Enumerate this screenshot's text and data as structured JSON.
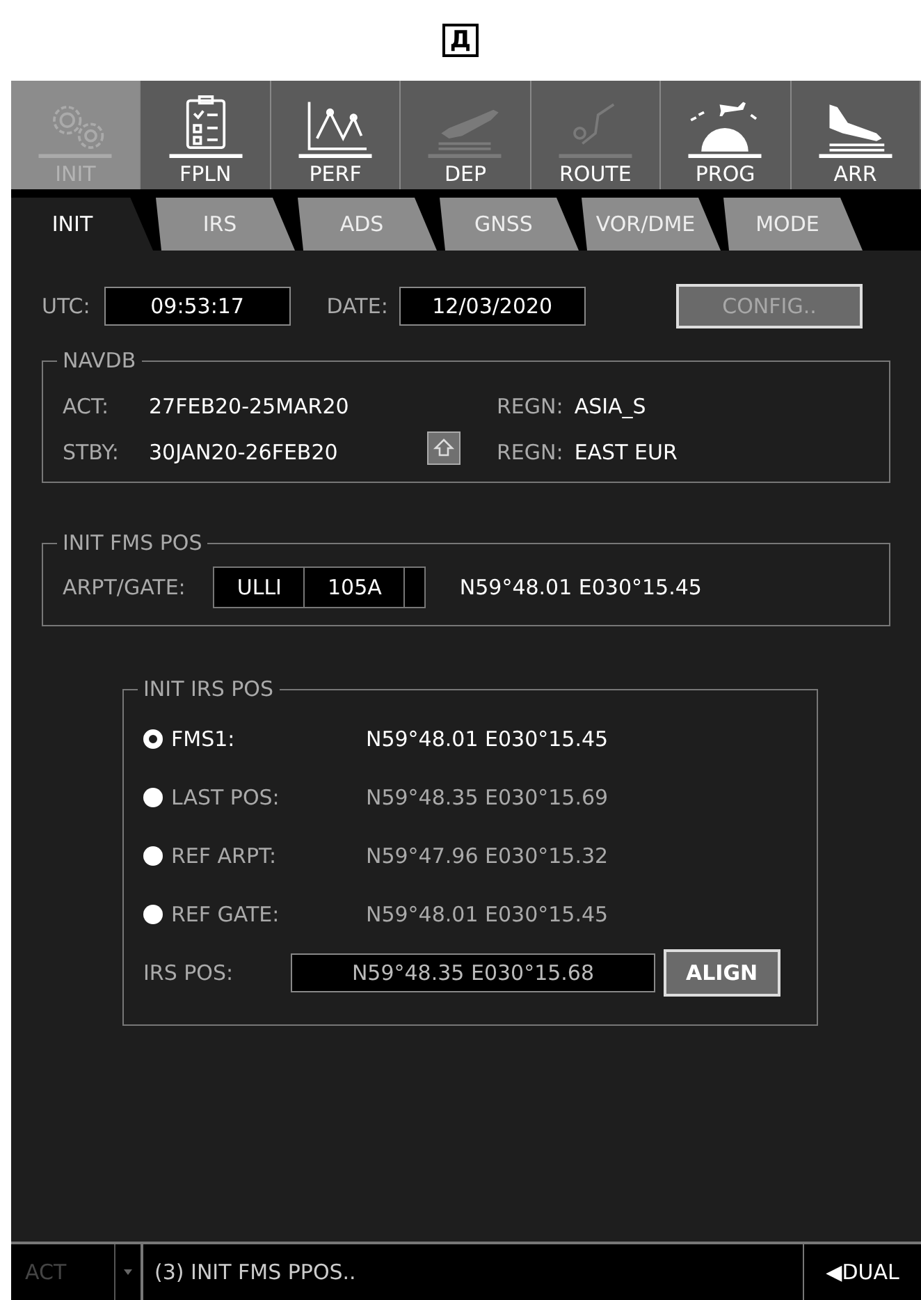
{
  "figure_label": "Д",
  "nav": [
    {
      "label": "INIT",
      "kind": "gear",
      "selected": true,
      "dimmed": false
    },
    {
      "label": "FPLN",
      "kind": "clipboard",
      "selected": false,
      "dimmed": false
    },
    {
      "label": "PERF",
      "kind": "chart",
      "selected": false,
      "dimmed": false
    },
    {
      "label": "DEP",
      "kind": "takeoff",
      "selected": false,
      "dimmed": true
    },
    {
      "label": "ROUTE",
      "kind": "route",
      "selected": false,
      "dimmed": true
    },
    {
      "label": "PROG",
      "kind": "progress",
      "selected": false,
      "dimmed": false
    },
    {
      "label": "ARR",
      "kind": "landing",
      "selected": false,
      "dimmed": false
    }
  ],
  "tabs": [
    {
      "label": "INIT",
      "selected": true
    },
    {
      "label": "IRS",
      "selected": false
    },
    {
      "label": "ADS",
      "selected": false
    },
    {
      "label": "GNSS",
      "selected": false
    },
    {
      "label": "VOR/DME",
      "selected": false
    },
    {
      "label": "MODE",
      "selected": false
    }
  ],
  "utc": {
    "label": "UTC:",
    "value": "09:53:17"
  },
  "date": {
    "label": "DATE:",
    "value": "12/03/2020"
  },
  "config_button": {
    "label": "CONFIG..",
    "disabled": true
  },
  "navdb": {
    "title": "NAVDB",
    "act": {
      "label": "ACT:",
      "value": "27FEB20-25MAR20",
      "regn_label": "REGN:",
      "regn": "ASIA_S"
    },
    "stby": {
      "label": "STBY:",
      "value": "30JAN20-26FEB20",
      "regn_label": "REGN:",
      "regn": "EAST EUR"
    }
  },
  "init_fms_pos": {
    "title": "INIT FMS POS",
    "label": "ARPT/GATE:",
    "airport": "ULLI",
    "gate": "105A",
    "position": "N59°48.01 E030°15.45"
  },
  "init_irs_pos": {
    "title": "INIT IRS POS",
    "options": [
      {
        "label": "FMS1:",
        "position": "N59°48.01 E030°15.45",
        "selected": true
      },
      {
        "label": "LAST POS:",
        "position": "N59°48.35 E030°15.69",
        "selected": false
      },
      {
        "label": "REF ARPT:",
        "position": "N59°47.96 E030°15.32",
        "selected": false
      },
      {
        "label": "REF GATE:",
        "position": "N59°48.01 E030°15.45",
        "selected": false
      }
    ],
    "irs_pos_label": "IRS POS:",
    "irs_pos": "N59°48.35 E030°15.68",
    "align_button": "ALIGN"
  },
  "status_bar": {
    "mode": "ACT",
    "message": "(3) INIT FMS PPOS..",
    "side": "◀DUAL"
  }
}
